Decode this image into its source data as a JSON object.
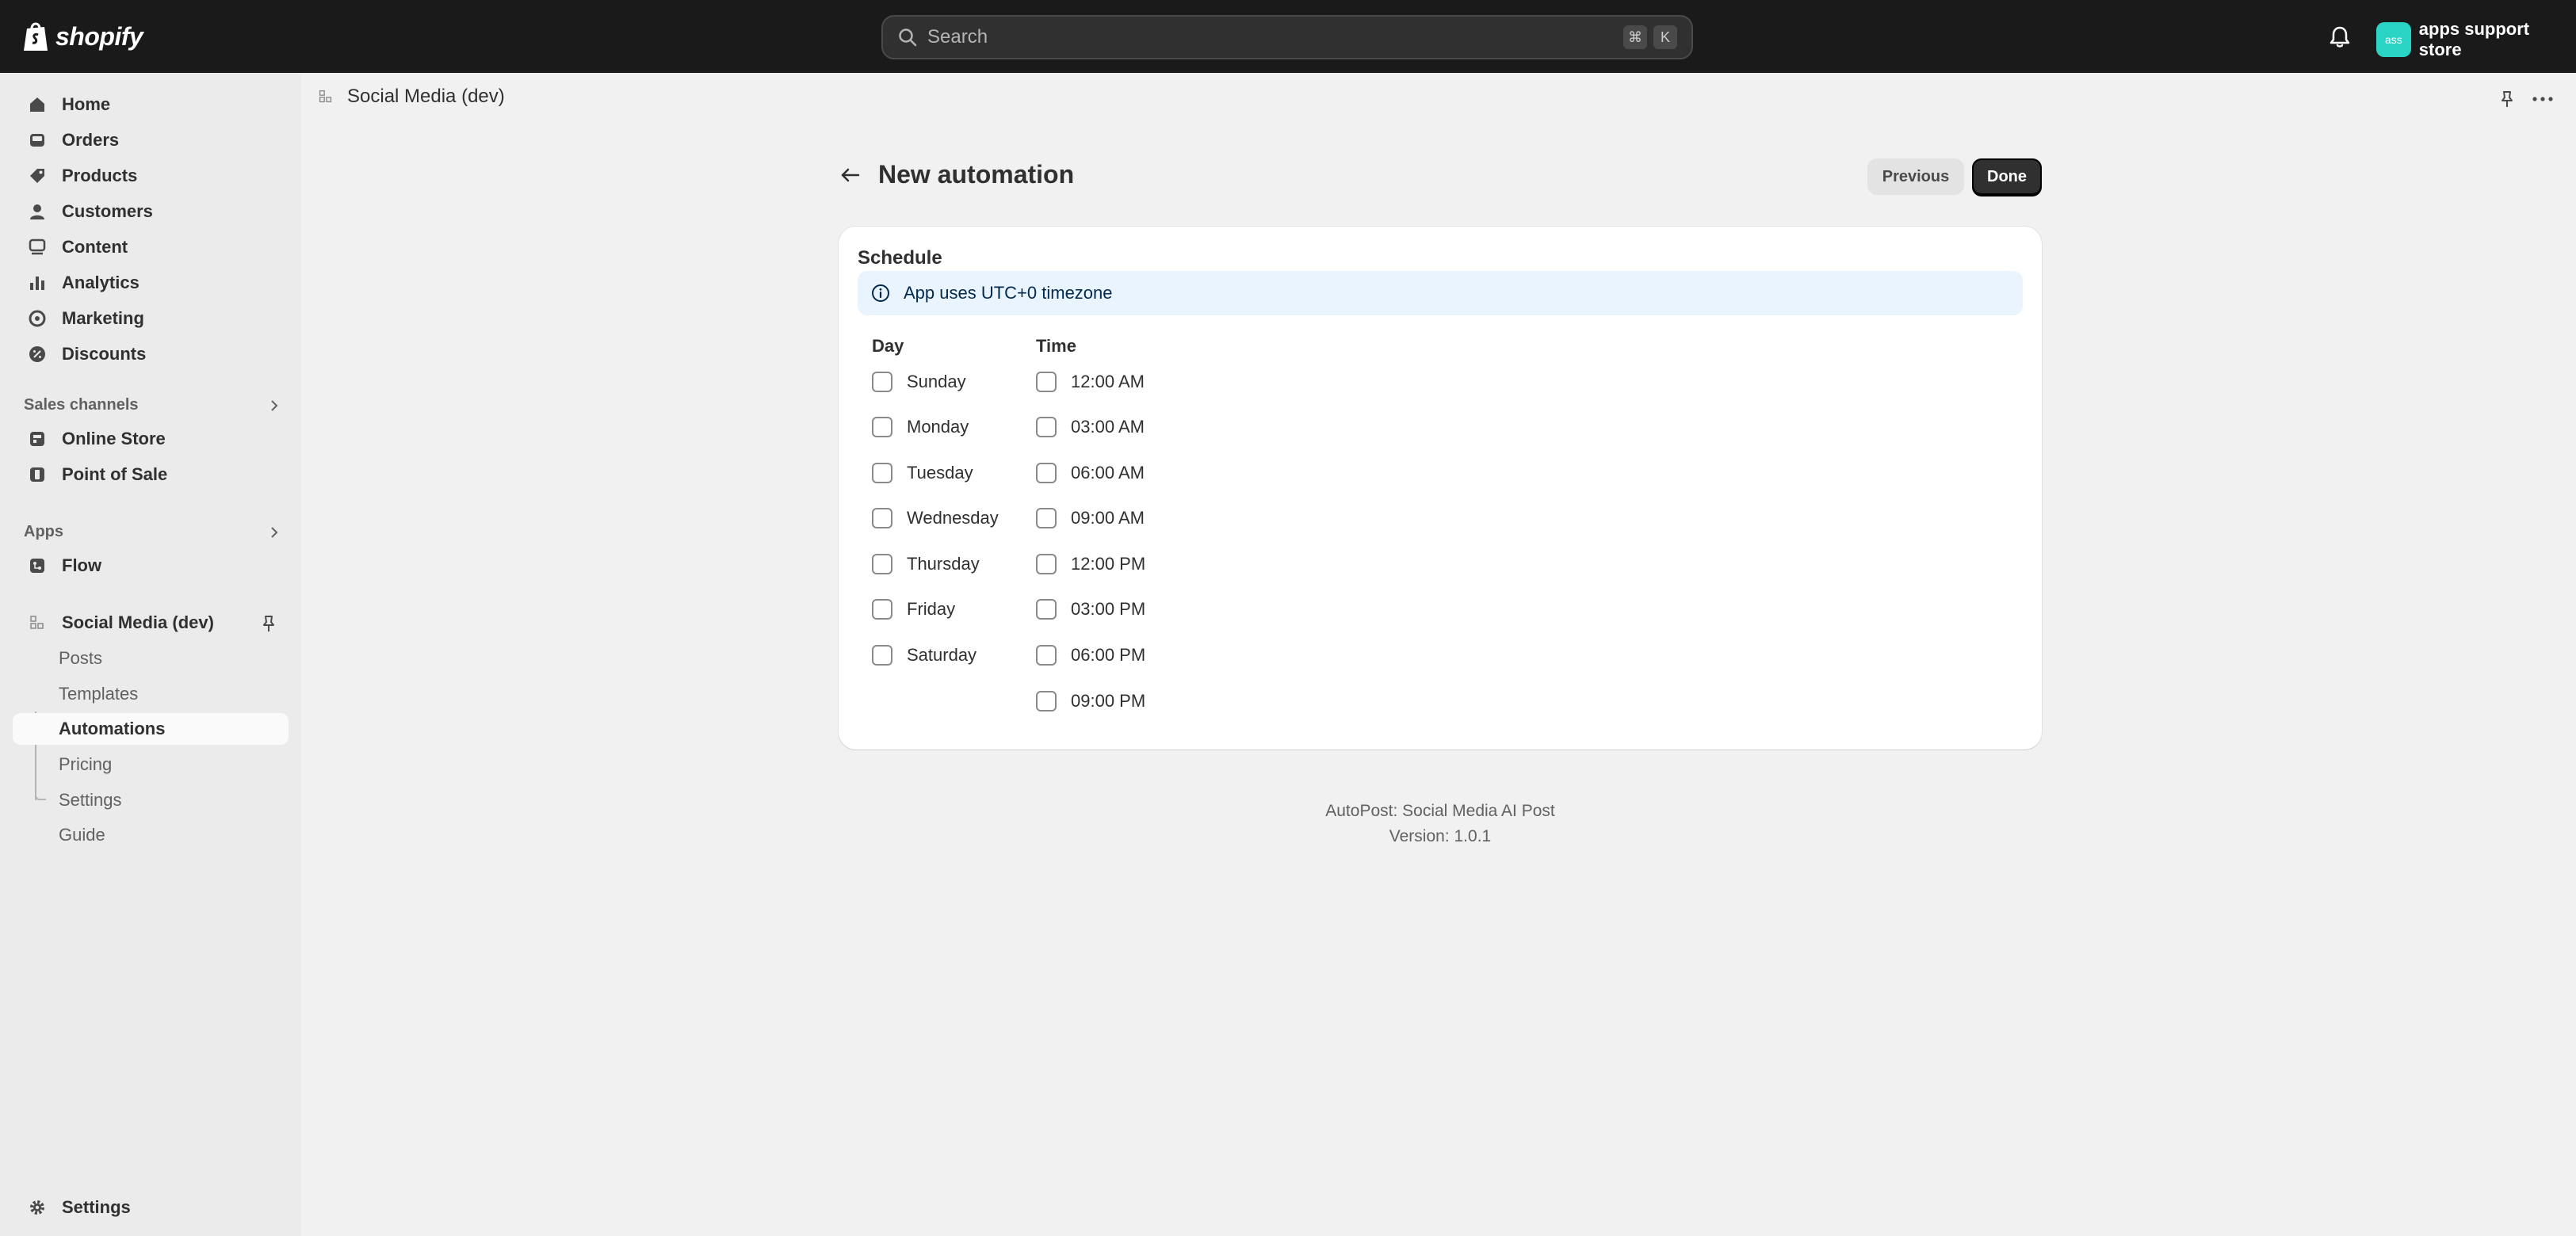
{
  "topbar": {
    "logo_text": "shopify",
    "search_placeholder": "Search",
    "shortcut_keys": [
      "⌘",
      "K"
    ],
    "store_initials": "ass",
    "store_name": "apps support store",
    "avatar_color": "#2ad4c5"
  },
  "sidebar": {
    "main_items": [
      {
        "label": "Home",
        "icon": "home-icon"
      },
      {
        "label": "Orders",
        "icon": "inbox-icon"
      },
      {
        "label": "Products",
        "icon": "tag-icon"
      },
      {
        "label": "Customers",
        "icon": "person-icon"
      },
      {
        "label": "Content",
        "icon": "content-icon"
      },
      {
        "label": "Analytics",
        "icon": "bar-chart-icon"
      },
      {
        "label": "Marketing",
        "icon": "target-icon"
      },
      {
        "label": "Discounts",
        "icon": "discount-icon"
      }
    ],
    "sales_channels_heading": "Sales channels",
    "sales_channels": [
      {
        "label": "Online Store",
        "icon": "store-icon"
      },
      {
        "label": "Point of Sale",
        "icon": "pos-icon"
      }
    ],
    "apps_heading": "Apps",
    "apps": [
      {
        "label": "Flow",
        "icon": "flow-icon"
      }
    ],
    "app_title": "Social Media (dev)",
    "app_subitems": [
      "Posts",
      "Templates",
      "Automations",
      "Pricing",
      "Settings",
      "Guide"
    ],
    "active_subitem": "Automations",
    "settings_label": "Settings"
  },
  "page_bar": {
    "app_title": "Social Media (dev)"
  },
  "header": {
    "title": "New automation",
    "previous_label": "Previous",
    "done_label": "Done"
  },
  "schedule": {
    "title": "Schedule",
    "banner_text": "App uses UTC+0 timezone",
    "day_header": "Day",
    "time_header": "Time",
    "days": [
      "Sunday",
      "Monday",
      "Tuesday",
      "Wednesday",
      "Thursday",
      "Friday",
      "Saturday"
    ],
    "times": [
      "12:00 AM",
      "03:00 AM",
      "06:00 AM",
      "09:00 AM",
      "12:00 PM",
      "03:00 PM",
      "06:00 PM",
      "09:00 PM"
    ]
  },
  "footer": {
    "line1": "AutoPost: Social Media AI Post",
    "line2": "Version: 1.0.1"
  }
}
